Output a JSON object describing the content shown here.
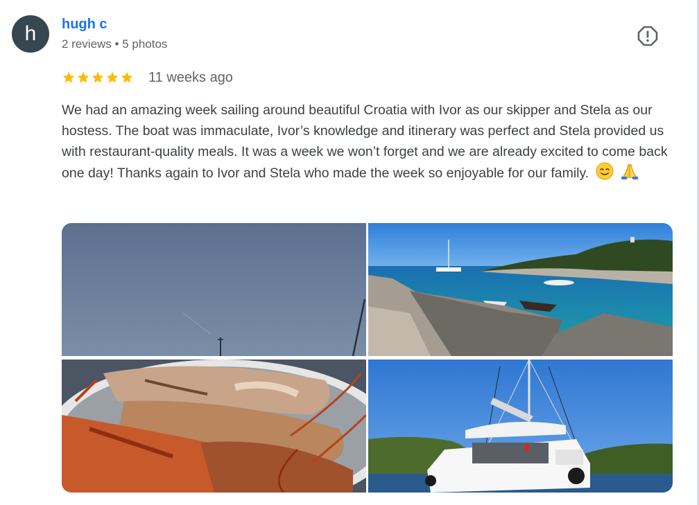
{
  "review": {
    "author": {
      "initial": "h",
      "name": "hugh c",
      "meta": "2 reviews • 5 photos"
    },
    "rating": 5,
    "time": "11 weeks ago",
    "text": "We had an amazing week sailing around beautiful Croatia with Ivor as our skipper and Stela as our hostess. The boat was immaculate, Ivor’s knowledge and itinerary was perfect and Stela provided us with restaurant-quality meals. It was a week we won’t forget and we are already excited to come back one day! Thanks again to Ivor and Stela who made the week so enjoyable for our family.",
    "emojis": [
      "smiling-face-emoji",
      "folded-hands-emoji"
    ],
    "photos": [
      {
        "subject": "sky-with-mast"
      },
      {
        "subject": "bay-with-boats"
      },
      {
        "subject": "grilled-lobsters"
      },
      {
        "subject": "catamaran"
      }
    ]
  },
  "colors": {
    "name": "#1a73e8",
    "star": "#fbbc04",
    "text": "#3c4043",
    "muted": "#5f6368",
    "avatar": "#37474f"
  },
  "icons": {
    "report": "report-flag-icon",
    "star": "star-icon"
  }
}
